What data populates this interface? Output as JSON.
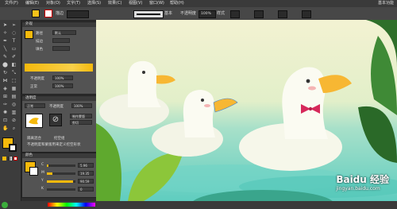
{
  "menubar": {
    "items": [
      "文件(F)",
      "编辑(E)",
      "对象(O)",
      "文字(T)",
      "选择(S)",
      "效果(C)",
      "视图(V)",
      "窗口(W)",
      "帮助(H)"
    ],
    "right": "基本功能"
  },
  "controlbar": {
    "fill_color": "#f7c31a",
    "stroke_label": "描边",
    "stroke_value": "",
    "basic_label": "基本",
    "opacity_label": "不透明度",
    "opacity_value": "100%",
    "style_label": "样式"
  },
  "colors": {
    "accent_yellow": "#f5b90c",
    "duck_body": "#fbfbf2",
    "beak": "#f7b733",
    "bow": "#d6285a",
    "water": "#63d1c7",
    "leaf": "#7dbb32"
  },
  "panels": {
    "appearance": {
      "title": "外观",
      "path_label": "路径",
      "stroke_label": "描边",
      "fill_label": "填色",
      "opacity_label": "不透明度",
      "opacity_value": "100%",
      "opacity2_value": "100%",
      "normal_label": "正常",
      "mode_value": "默认"
    },
    "transparency": {
      "title": "透明度",
      "mode": "正常",
      "opacity_label": "不透明度",
      "opacity_value": "100%",
      "make_mask": "制作蒙版",
      "clip_label": "剪切",
      "invert_label": "反相蒙版",
      "isolate_label": "隔离混合",
      "knockout_label": "挖空组",
      "opacity_mask_label": "不透明度和蒙版用来定义挖空形状"
    },
    "color": {
      "title": "颜色",
      "channels": [
        {
          "name": "C",
          "value": "5.96",
          "fill": 0.06
        },
        {
          "name": "M",
          "value": "19.35",
          "fill": 0.19
        },
        {
          "name": "Y",
          "value": "90.59",
          "fill": 0.91
        },
        {
          "name": "K",
          "value": "0",
          "fill": 0.0
        }
      ]
    }
  },
  "watermark": {
    "main": "Baidu 经验",
    "url": "jingyan.baidu.com"
  }
}
